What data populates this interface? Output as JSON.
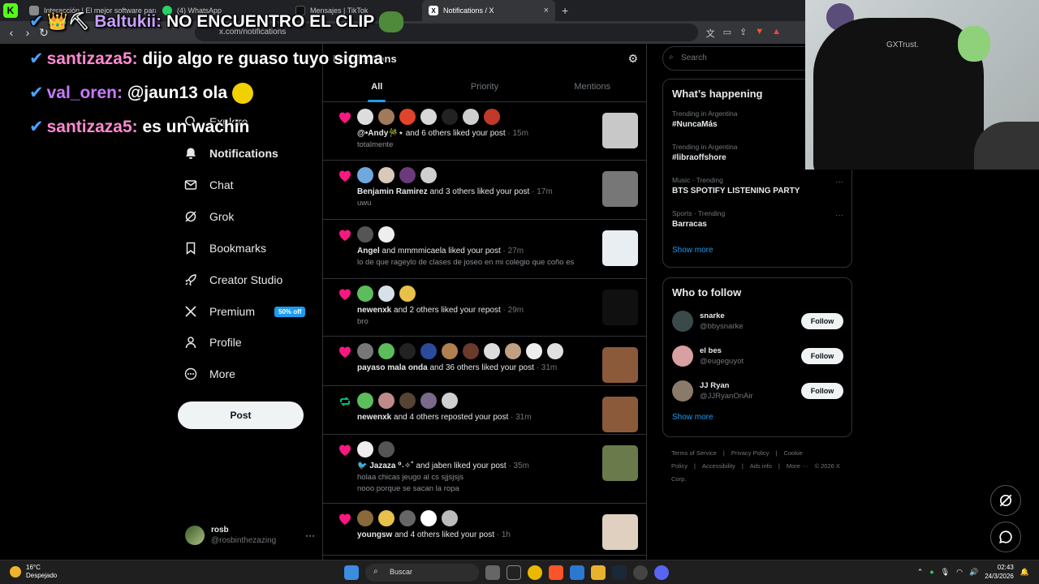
{
  "browser": {
    "tabs": [
      {
        "label": "Interacción | El mejor software para ",
        "color": "#8a8a8a"
      },
      {
        "label": "(4) WhatsApp",
        "color": "#25d366"
      },
      {
        "label": "Mensajes | TikTok",
        "color": "#111111"
      },
      {
        "label": "Notifications / X",
        "color": "#000000",
        "close": "×"
      }
    ],
    "new_tab": "+",
    "url": "x.com/notifications"
  },
  "nav": {
    "items": [
      {
        "label": "Explore"
      },
      {
        "label": "Notifications"
      },
      {
        "label": "Chat"
      },
      {
        "label": "Grok"
      },
      {
        "label": "Bookmarks"
      },
      {
        "label": "Creator Studio"
      },
      {
        "label": "Premium",
        "badge": "50% off"
      },
      {
        "label": "Profile"
      },
      {
        "label": "More"
      }
    ],
    "post_label": "Post",
    "profile": {
      "name": "rosb",
      "handle": "@rosbinthezazing",
      "more": "···"
    }
  },
  "main": {
    "title": "Notifications",
    "tabs": [
      "All",
      "Priority",
      "Mentions"
    ],
    "notifications": [
      {
        "type": "like",
        "names": "@•Andy🎋⋆",
        "rest": " and 6 others liked your post",
        "time": " · 15m",
        "sub1": "totalmente",
        "sub2": "",
        "avatars": [
          "#dddddd",
          "#a07a5a",
          "#e0442a",
          "#d8d8d8",
          "#222222",
          "#cfcfcf",
          "#c0392b"
        ],
        "thumb": "#c8c8c8"
      },
      {
        "type": "like",
        "names": "Benjamin Ramirez",
        "rest": " and 3 others liked your post",
        "time": " · 17m",
        "sub1": "uwu",
        "sub2": "",
        "avatars": [
          "#6fa8dc",
          "#d9c9b8",
          "#6a3a7a",
          "#cfcfcf"
        ],
        "thumb": "#777777"
      },
      {
        "type": "like",
        "names": "Angel",
        "rest": " and mmmmicaela liked your post",
        "time": " · 27m",
        "sub1": "lo de que rageylo de clases de joseo en mi colegio que coño es",
        "sub2": "",
        "avatars": [
          "#555555",
          "#eeeeee"
        ],
        "thumb": "#e8eef2"
      },
      {
        "type": "like",
        "names": "newenxk",
        "rest": " and 2 others liked your repost",
        "time": " · 29m",
        "sub1": "bro",
        "sub2": "",
        "avatars": [
          "#5cbd5c",
          "#d8e0e8",
          "#e8c14a"
        ],
        "thumb": "#101010"
      },
      {
        "type": "like",
        "names": "payaso mala onda",
        "rest": " and 36 others liked your post",
        "time": " · 31m",
        "sub1": "",
        "sub2": "",
        "avatars": [
          "#777777",
          "#5cbd5c",
          "#222222",
          "#2a4a9a",
          "#b08050",
          "#6a3a2a",
          "#dddddd",
          "#c0a080",
          "#eeeeee",
          "#e0e0e0"
        ],
        "thumb": "#8a5a3a"
      },
      {
        "type": "repost",
        "names": "newenxk",
        "rest": " and 4 others reposted your post",
        "time": " · 31m",
        "sub1": "",
        "sub2": "",
        "avatars": [
          "#5cbd5c",
          "#c08a8a",
          "#554433",
          "#7a6a8a",
          "#cfcfcf"
        ],
        "thumb": "#8a5a3a"
      },
      {
        "type": "like",
        "names": "🐦 Jazaza ⁰˖✧˚",
        "rest": " and jaben liked your post",
        "time": " · 35m",
        "sub1": "holaa chicas jeugo al cs sjjsjsjs",
        "sub2": "nooo porque se sacan la ropa",
        "avatars": [
          "#eeeeee",
          "#555555"
        ],
        "thumb": "#6a7a4a"
      },
      {
        "type": "like",
        "names": "youngsw",
        "rest": " and 4 others liked your post",
        "time": " · 1h",
        "sub1": "",
        "sub2": "",
        "avatars": [
          "#8a6a3a",
          "#e8c14a",
          "#666666",
          "#ffffff",
          "#bbbbbb"
        ],
        "thumb": "#e0d0c0"
      }
    ]
  },
  "right": {
    "search_placeholder": "Search",
    "happening_title": "What’s happening",
    "trends": [
      {
        "context": "Trending in Argentina",
        "name": "#NuncaMás",
        "dots": ""
      },
      {
        "context": "Trending in Argentina",
        "name": "#libraoffshore",
        "dots": ""
      },
      {
        "context": "Music · Trending",
        "name": "BTS SPOTIFY LISTENING PARTY",
        "dots": "···"
      },
      {
        "context": "Sports · Trending",
        "name": "Barracas",
        "dots": "···"
      }
    ],
    "show_more": "Show more",
    "who_title": "Who to follow",
    "follows": [
      {
        "name": "snarke",
        "handle": "@bbysnarke",
        "btn": "Follow",
        "color": "#3a4a4a"
      },
      {
        "name": "el bes",
        "handle": "@eugeguyot",
        "btn": "Follow",
        "color": "#d8a0a0"
      },
      {
        "name": "JJ Ryan",
        "handle": "@JJRyanOnAir",
        "btn": "Follow",
        "color": "#8a7a6a"
      }
    ],
    "show_more2": "Show more",
    "footer": [
      "Terms of Service",
      "|",
      "Privacy Policy",
      "|",
      "Cookie Policy",
      "|",
      "Accessibility",
      "|",
      "Ads info",
      "|",
      "More ···",
      "© 2026 X Corp."
    ]
  },
  "webcam": {
    "brand": "GXTrust."
  },
  "chat": [
    {
      "user": "Baltukii:",
      "user_color": "#c9a0ff",
      "msg": " NO ENCUENTRO EL CLIP",
      "prefix": "👑⛏"
    },
    {
      "user": "santizaza5:",
      "user_color": "#ff8ad0",
      "msg": " dijo algo re guaso tuyo sigma",
      "prefix": ""
    },
    {
      "user": "val_oren:",
      "user_color": "#c879ff",
      "msg": " @jaun13 ola",
      "prefix": ""
    },
    {
      "user": "santizaza5:",
      "user_color": "#ff8ad0",
      "msg": " es un wachin",
      "prefix": ""
    }
  ],
  "taskbar": {
    "temp": "16°C",
    "condition": "Despejado",
    "search": "Buscar",
    "time": "02:43",
    "date": "24/3/2026"
  }
}
